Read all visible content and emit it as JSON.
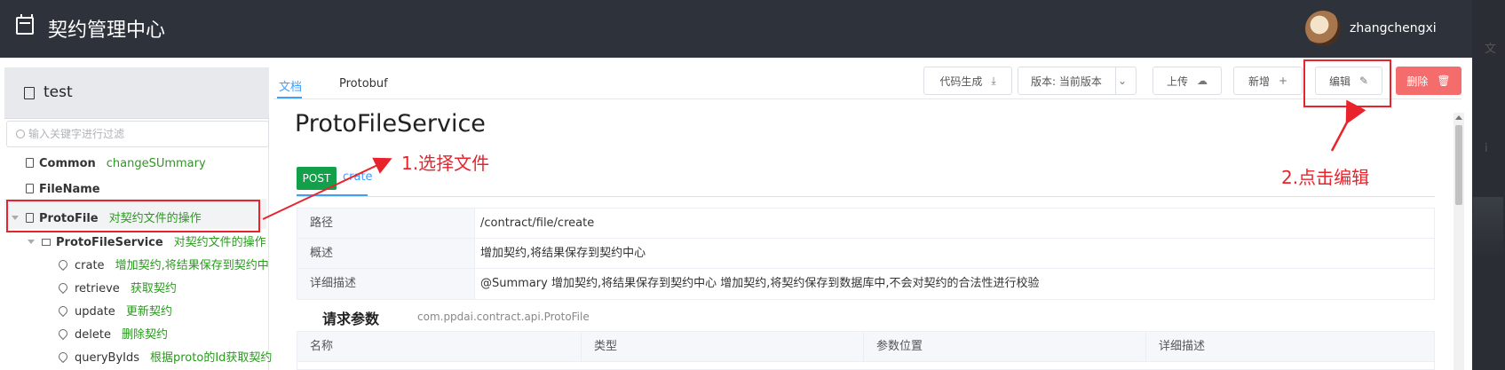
{
  "header": {
    "app_title": "契约管理中心",
    "username": "zhangchengxi"
  },
  "right_strip": {
    "char_1": "文",
    "char_2": "ⅰ"
  },
  "sidebar": {
    "project_name": "test",
    "filter_placeholder": "输入关键字进行过滤",
    "items": [
      {
        "name": "Common",
        "desc": "changeSUmmary"
      },
      {
        "name": "FileName",
        "desc": ""
      },
      {
        "name": "ProtoFile",
        "desc": "对契约文件的操作"
      },
      {
        "name": "ProtoFileService",
        "desc": "对契约文件的操作"
      },
      {
        "name": "crate",
        "desc": "增加契约,将结果保存到契约中"
      },
      {
        "name": "retrieve",
        "desc": "获取契约"
      },
      {
        "name": "update",
        "desc": "更新契约"
      },
      {
        "name": "delete",
        "desc": "删除契约"
      },
      {
        "name": "queryByIds",
        "desc": "根据proto的Id获取契约"
      }
    ]
  },
  "tabs": [
    "文档",
    "Protobuf"
  ],
  "toolbar": {
    "codegen": "代码生成",
    "version": "版本: 当前版本",
    "upload": "上传",
    "add": "新增",
    "edit": "编辑",
    "delete": "删除"
  },
  "main": {
    "service_title": "ProtoFileService",
    "method_badge": "POST",
    "method_name": "crate",
    "info_rows": [
      {
        "key": "路径",
        "value": "/contract/file/create"
      },
      {
        "key": "概述",
        "value": "增加契约,将结果保存到契约中心"
      },
      {
        "key": "详细描述",
        "value": "@Summary 增加契约,将结果保存到契约中心 增加契约,将契约保存到数据库中,不会对契约的合法性进行校验"
      }
    ],
    "request_title": "请求参数",
    "request_class": "com.ppdai.contract.api.ProtoFile",
    "param_headers": [
      "名称",
      "类型",
      "参数位置",
      "详细描述"
    ]
  },
  "annotations": {
    "step1": "1.选择文件",
    "step2": "2.点击编辑"
  },
  "colors": {
    "header_bg": "#2e323b",
    "accent": "#409eff",
    "post_badge": "#13a04a",
    "danger": "#f56c6c",
    "annotation": "#e8232c",
    "desc_text": "#2a9a1e"
  }
}
